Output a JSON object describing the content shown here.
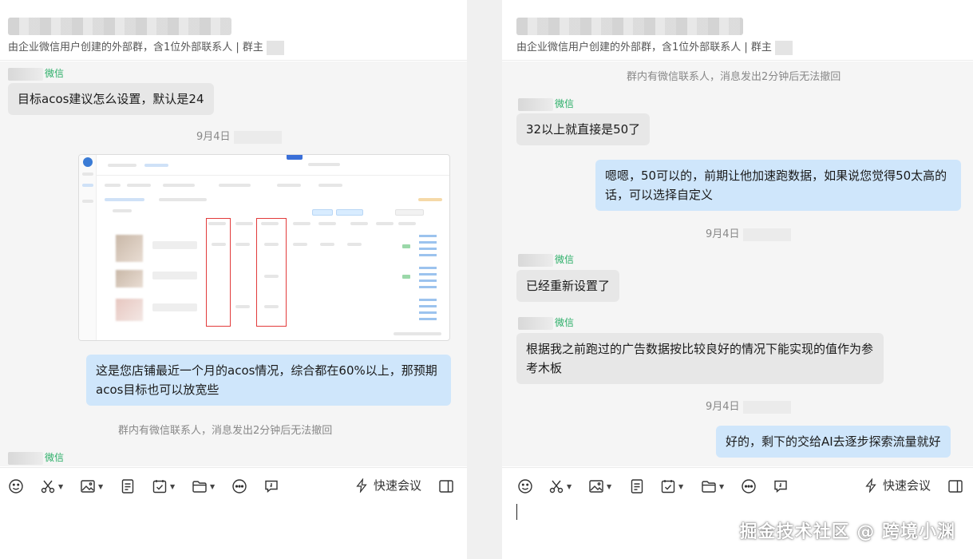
{
  "left": {
    "subtitle": "由企业微信用户创建的外部群，含1位外部联系人 | 群主",
    "messages": [
      {
        "sender_suffix": "微信",
        "text": "目标acos建议怎么设置，默认是24"
      },
      {
        "timestamp": "9月4日"
      },
      {
        "text": "这是您店铺最近一个月的acos情况，综合都在60%以上，那预期acos目标也可以放宽些"
      },
      {
        "sysnote": "群内有微信联系人，消息发出2分钟后无法撤回"
      },
      {
        "sender_suffix": "微信"
      }
    ],
    "quick_meeting": "快速会议"
  },
  "right": {
    "subtitle": "由企业微信用户创建的外部群，含1位外部联系人 | 群主",
    "messages": [
      {
        "sysnote": "群内有微信联系人，消息发出2分钟后无法撤回"
      },
      {
        "sender_suffix": "微信",
        "text": "32以上就直接是50了"
      },
      {
        "text": "嗯嗯，50可以的，前期让他加速跑数据，如果说您觉得50太高的话，可以选择自定义"
      },
      {
        "timestamp": "9月4日"
      },
      {
        "sender_suffix": "微信",
        "text": "已经重新设置了"
      },
      {
        "sender_suffix": "微信",
        "text": "根据我之前跑过的广告数据按比较良好的情况下能实现的值作为参考木板"
      },
      {
        "timestamp": "9月4日"
      },
      {
        "text": "好的，剩下的交给AI去逐步探索流量就好"
      }
    ],
    "quick_meeting": "快速会议"
  },
  "watermark": "掘金技术社区 @ 跨境小渊",
  "colors": {
    "outgoing_bubble": "#cfe6fb",
    "incoming_bubble": "#e7e7e7",
    "wechat_green": "#2aae67",
    "highlight_red": "#e23b3b"
  },
  "toolbar_icons": [
    "emoji-icon",
    "scissors-icon",
    "image-icon",
    "document-icon",
    "task-icon",
    "folder-icon",
    "more-icon",
    "edit-icon",
    "lightning-icon",
    "sidebar-icon"
  ]
}
